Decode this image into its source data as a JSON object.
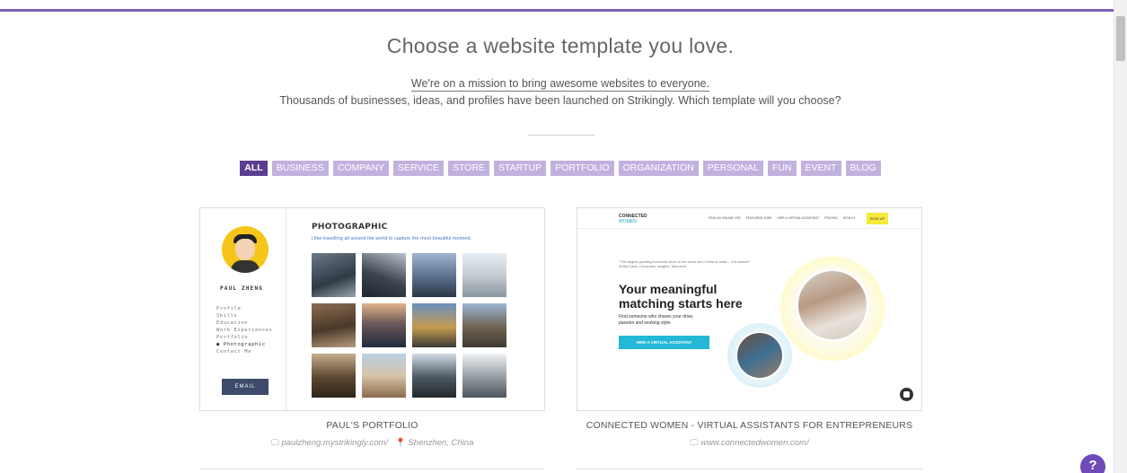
{
  "header": {
    "title": "Choose a website template you love.",
    "mission": "We're on a mission to bring awesome websites to everyone.",
    "subline": "Thousands of businesses, ideas, and profiles have been launched on Strikingly. Which template will you choose?"
  },
  "filters": [
    "ALL",
    "BUSINESS",
    "COMPANY",
    "SERVICE",
    "STORE",
    "STARTUP",
    "PORTFOLIO",
    "ORGANIZATION",
    "PERSONAL",
    "FUN",
    "EVENT",
    "BLOG"
  ],
  "active_filter": "ALL",
  "colors": {
    "accent": "#7c5fb3",
    "filter_active": "#5b3e91",
    "filter_inactive": "#c2b1de",
    "help_button": "#6e4bb8"
  },
  "templates": [
    {
      "name": "PAUL'S PORTFOLIO",
      "url": "paulzheng.mystrikingly.com/",
      "location": "Shenzhen, China",
      "preview": {
        "person_name": "PAUL ZHENG",
        "nav": [
          "Profile",
          "Skills",
          "Education",
          "Work Experiences",
          "Portfolio",
          "Photographic",
          "Contact Me"
        ],
        "current_nav": "Photographic",
        "email_label": "EMAIL",
        "heading": "PHOTOGRAPHIC",
        "tagline": "I like travelling all around the world to capture the most beautiful moment."
      }
    },
    {
      "name": "CONNECTED WOMEN - VIRTUAL ASSISTANTS FOR ENTREPRENEURS",
      "url": "www.connectedwomen.com/",
      "preview": {
        "logo_top": "CONNECTED",
        "logo_bottom": "WOMEN",
        "nav": [
          "FIND AN ONLINE JOB",
          "FEATURED JOBS",
          "HIRE A VIRTUAL ASSISTANT",
          "PRICING",
          "SIGN IN"
        ],
        "signup": "SIGN UP",
        "quote": "\"The largest growing economic force in the world isn't China or India – it is women\"",
        "quote_author": "Aniha Cariu, Consumer Insights, Microsoft",
        "headline_1": "Your meaningful",
        "headline_2": "matching starts here",
        "desc_1": "Find someone who shares your drive,",
        "desc_2": "passion and working style.",
        "cta": "HIRE A VIRTUAL ASSISTANT"
      }
    }
  ],
  "help_label": "?"
}
